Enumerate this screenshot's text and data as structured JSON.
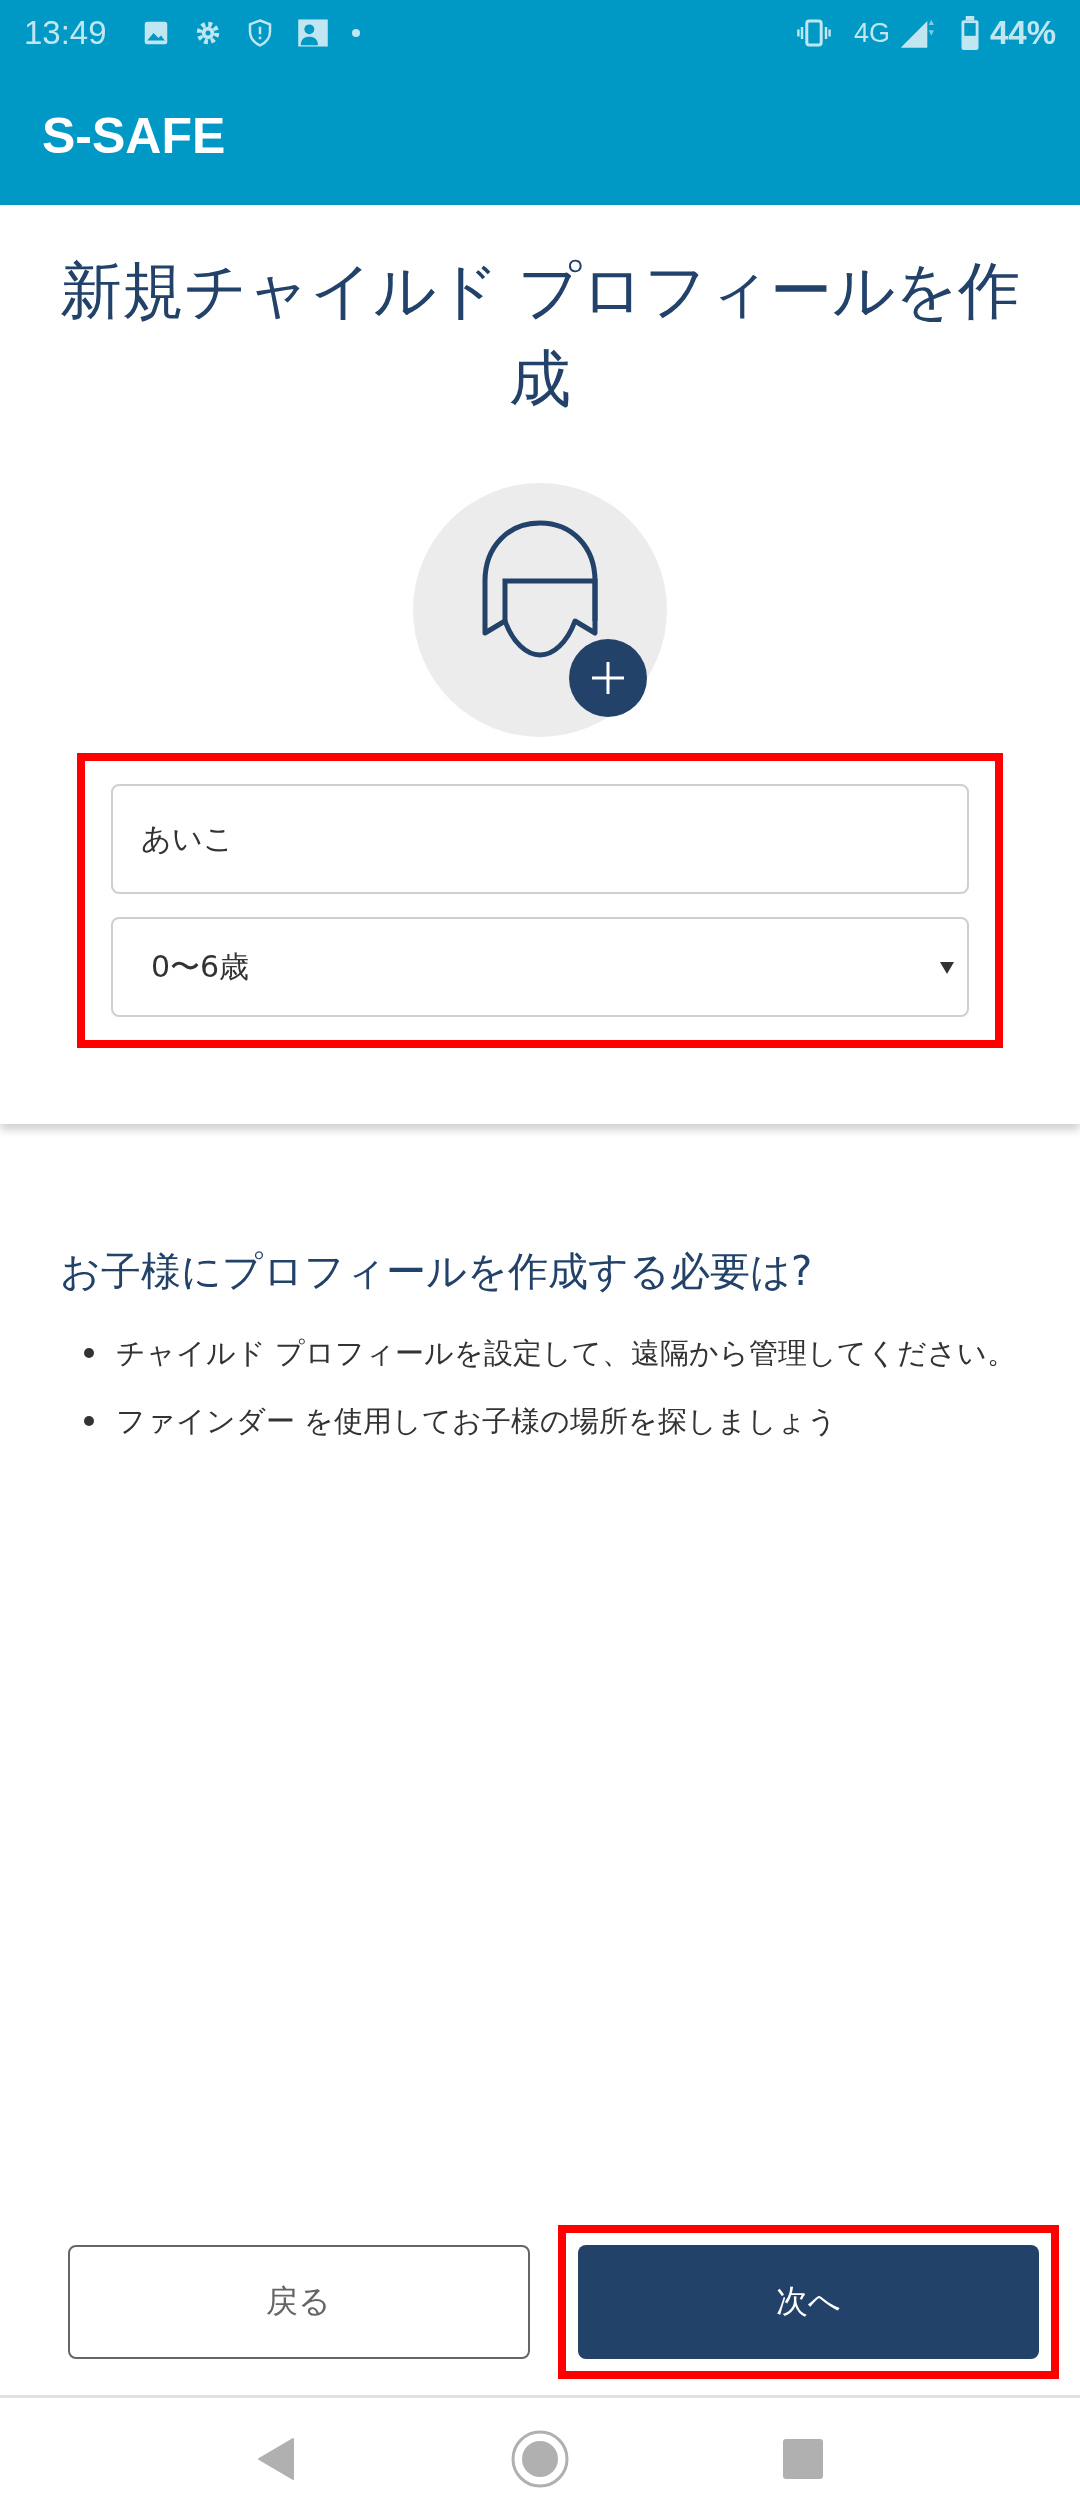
{
  "status_bar": {
    "time": "13:49",
    "network": "4G",
    "battery": "44%"
  },
  "app_bar": {
    "title": "S-SAFE"
  },
  "title": "新規チャイルド プロフィールを作成",
  "form": {
    "highlighted": true,
    "name_field": {
      "value": "あいこ"
    },
    "age_select": {
      "value": "0〜6歳"
    }
  },
  "info": {
    "heading": "お子様にプロフィールを作成する必要は?",
    "bullets": [
      "チャイルド プロフィールを設定して、遠隔から管理してください。",
      "ファインダー を使用してお子様の場所を探しましょう"
    ]
  },
  "buttons": [
    {
      "label": "戻る",
      "kind": "secondary",
      "highlighted": false
    },
    {
      "label": "次へ",
      "kind": "primary",
      "highlighted": true
    }
  ]
}
